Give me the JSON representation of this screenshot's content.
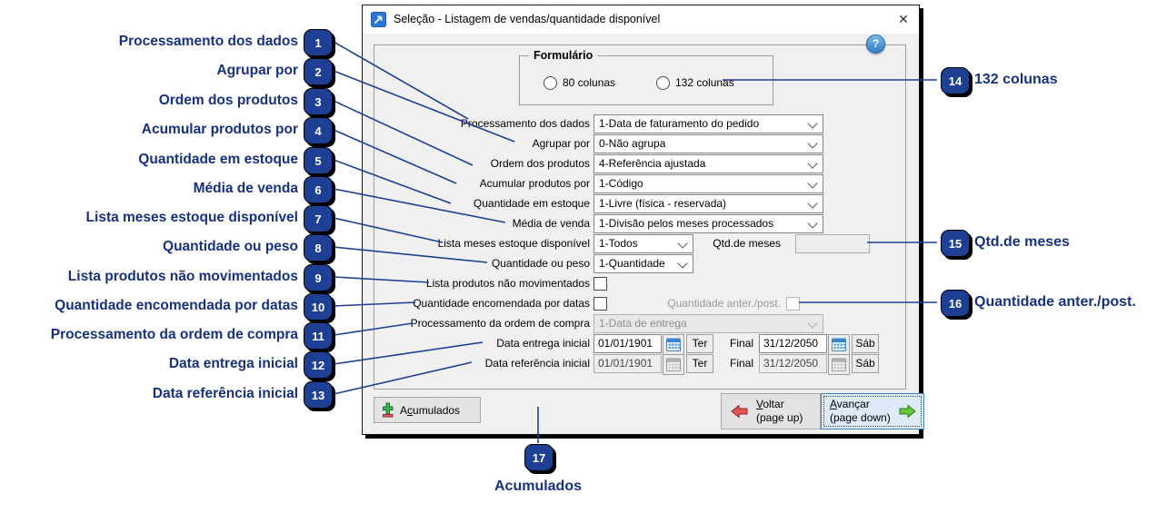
{
  "colors": {
    "annotation": "#17317e",
    "badge_fill": "#1d3f94",
    "focus_border": "#3c83c8",
    "calendar_blue": "#2e86d6"
  },
  "window": {
    "title": "Seleção - Listagem de vendas/quantidade disponível",
    "close_icon": "✕",
    "help_icon": "?"
  },
  "formulario": {
    "legend": "Formulário",
    "radio1": "80 colunas",
    "radio2": "132 colunas"
  },
  "rows": [
    {
      "label": "Processamento dos dados",
      "value": "1-Data de faturamento do pedido"
    },
    {
      "label": "Agrupar por",
      "value": "0-Não agrupa"
    },
    {
      "label": "Ordem dos produtos",
      "value": "4-Referência ajustada"
    },
    {
      "label": "Acumular produtos por",
      "value": "1-Código"
    },
    {
      "label": "Quantidade em estoque",
      "value": "1-Livre (física - reservada)"
    },
    {
      "label": "Média de venda",
      "value": "1-Divisão pelos meses processados"
    },
    {
      "label": "Lista meses estoque disponível",
      "value": "1-Todos",
      "extra_label": "Qtd.de meses",
      "extra_value": ""
    },
    {
      "label": "Quantidade ou peso",
      "value": "1-Quantidade"
    },
    {
      "label": "Lista produtos não movimentados",
      "checked": false
    },
    {
      "label": "Quantidade encomendada por datas",
      "checked": false,
      "extra_label": "Quantidade anter./post.",
      "extra_checked": false
    },
    {
      "label": "Processamento da ordem de compra",
      "value": "1-Data de entrega",
      "disabled": true
    },
    {
      "label": "Data entrega inicial",
      "start": "01/01/1901",
      "start_day": "Ter",
      "final_label": "Final",
      "end": "31/12/2050",
      "end_day": "Sáb"
    },
    {
      "label": "Data referência inicial",
      "start": "01/01/1901",
      "start_day": "Ter",
      "final_label": "Final",
      "end": "31/12/2050",
      "end_day": "Sáb",
      "disabled": true
    }
  ],
  "buttons": {
    "acumulados": {
      "pre": "A",
      "mn": "c",
      "post": "umulados"
    },
    "voltar": {
      "mn": "V",
      "post": "oltar",
      "sub": "(page up)"
    },
    "avancar": {
      "mn": "A",
      "post": "vançar",
      "sub": "(page down)"
    }
  },
  "callouts": {
    "left": [
      {
        "num": "1",
        "label": "Processamento dos dados"
      },
      {
        "num": "2",
        "label": "Agrupar por"
      },
      {
        "num": "3",
        "label": "Ordem dos produtos"
      },
      {
        "num": "4",
        "label": "Acumular produtos por"
      },
      {
        "num": "5",
        "label": "Quantidade em estoque"
      },
      {
        "num": "6",
        "label": "Média de venda"
      },
      {
        "num": "7",
        "label": "Lista meses estoque disponível"
      },
      {
        "num": "8",
        "label": "Quantidade ou peso"
      },
      {
        "num": "9",
        "label": "Lista produtos não movimentados"
      },
      {
        "num": "10",
        "label": "Quantidade encomendada por datas"
      },
      {
        "num": "11",
        "label": "Processamento da ordem de compra"
      },
      {
        "num": "12",
        "label": "Data entrega inicial"
      },
      {
        "num": "13",
        "label": "Data referência inicial"
      }
    ],
    "right": [
      {
        "num": "14",
        "label": "132 colunas"
      },
      {
        "num": "15",
        "label": "Qtd.de meses"
      },
      {
        "num": "16",
        "label": "Quantidade anter./post."
      }
    ],
    "bottom": {
      "num": "17",
      "label": "Acumulados"
    }
  }
}
